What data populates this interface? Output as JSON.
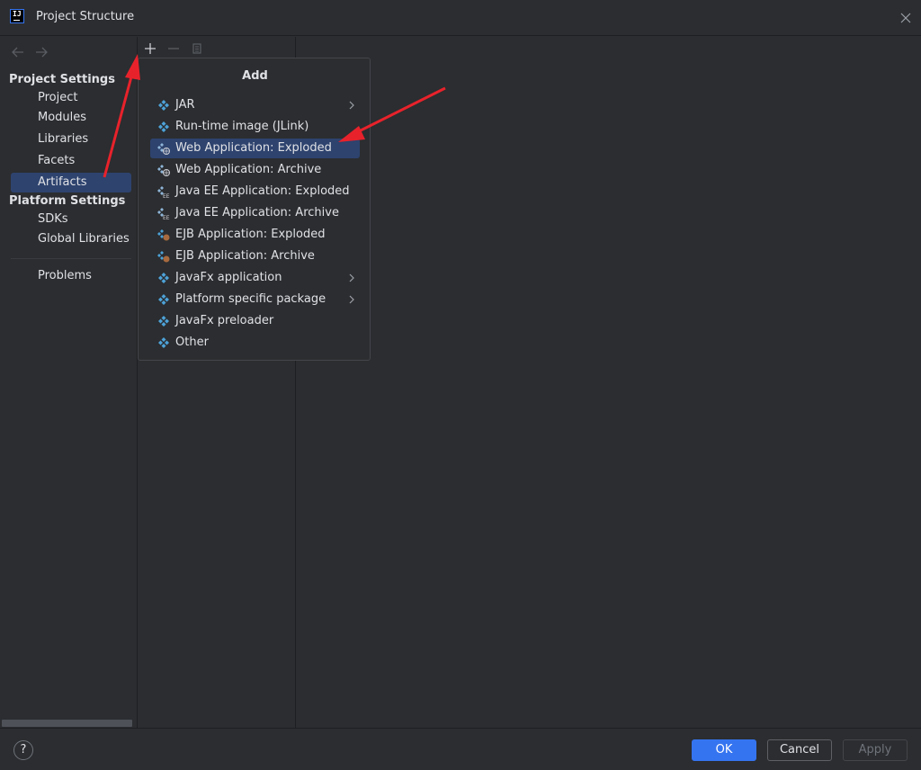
{
  "window": {
    "title": "Project Structure",
    "app_icon": "intellij-logo-icon",
    "logo_text": "IJ"
  },
  "sidebar": {
    "project_settings_title": "Project Settings",
    "project_items": [
      {
        "label": "Project",
        "selected": false
      },
      {
        "label": "Modules",
        "selected": false
      },
      {
        "label": "Libraries",
        "selected": false
      },
      {
        "label": "Facets",
        "selected": false
      },
      {
        "label": "Artifacts",
        "selected": true
      }
    ],
    "platform_settings_title": "Platform Settings",
    "platform_items": [
      {
        "label": "SDKs"
      },
      {
        "label": "Global Libraries"
      }
    ],
    "problems_label": "Problems"
  },
  "toolbar": {
    "add_icon": "plus-icon",
    "remove_icon": "minus-icon",
    "copy_icon": "copy-icon"
  },
  "popup": {
    "title": "Add",
    "items": [
      {
        "label": "JAR",
        "icon": "artifact-icon",
        "submenu": true,
        "selected": false
      },
      {
        "label": "Run-time image (JLink)",
        "icon": "artifact-icon",
        "submenu": false,
        "selected": false
      },
      {
        "label": "Web Application: Exploded",
        "icon": "web-artifact-icon",
        "submenu": false,
        "selected": true
      },
      {
        "label": "Web Application: Archive",
        "icon": "web-artifact-icon",
        "submenu": false,
        "selected": false
      },
      {
        "label": "Java EE Application: Exploded",
        "icon": "javaee-artifact-icon",
        "submenu": false,
        "selected": false
      },
      {
        "label": "Java EE Application: Archive",
        "icon": "javaee-artifact-icon",
        "submenu": false,
        "selected": false
      },
      {
        "label": "EJB Application: Exploded",
        "icon": "ejb-artifact-icon",
        "submenu": false,
        "selected": false
      },
      {
        "label": "EJB Application: Archive",
        "icon": "ejb-artifact-icon",
        "submenu": false,
        "selected": false
      },
      {
        "label": "JavaFx application",
        "icon": "artifact-icon",
        "submenu": true,
        "selected": false
      },
      {
        "label": "Platform specific package",
        "icon": "artifact-icon",
        "submenu": true,
        "selected": false
      },
      {
        "label": "JavaFx preloader",
        "icon": "artifact-icon",
        "submenu": false,
        "selected": false
      },
      {
        "label": "Other",
        "icon": "artifact-icon",
        "submenu": false,
        "selected": false
      }
    ]
  },
  "footer": {
    "help_label": "?",
    "ok_label": "OK",
    "cancel_label": "Cancel",
    "apply_label": "Apply"
  },
  "colors": {
    "background": "#2b2d30",
    "selection": "#2e436e",
    "accent": "#3574f0",
    "artifact_icon": "#4da2d8",
    "annotation_arrow": "#e8222b"
  }
}
